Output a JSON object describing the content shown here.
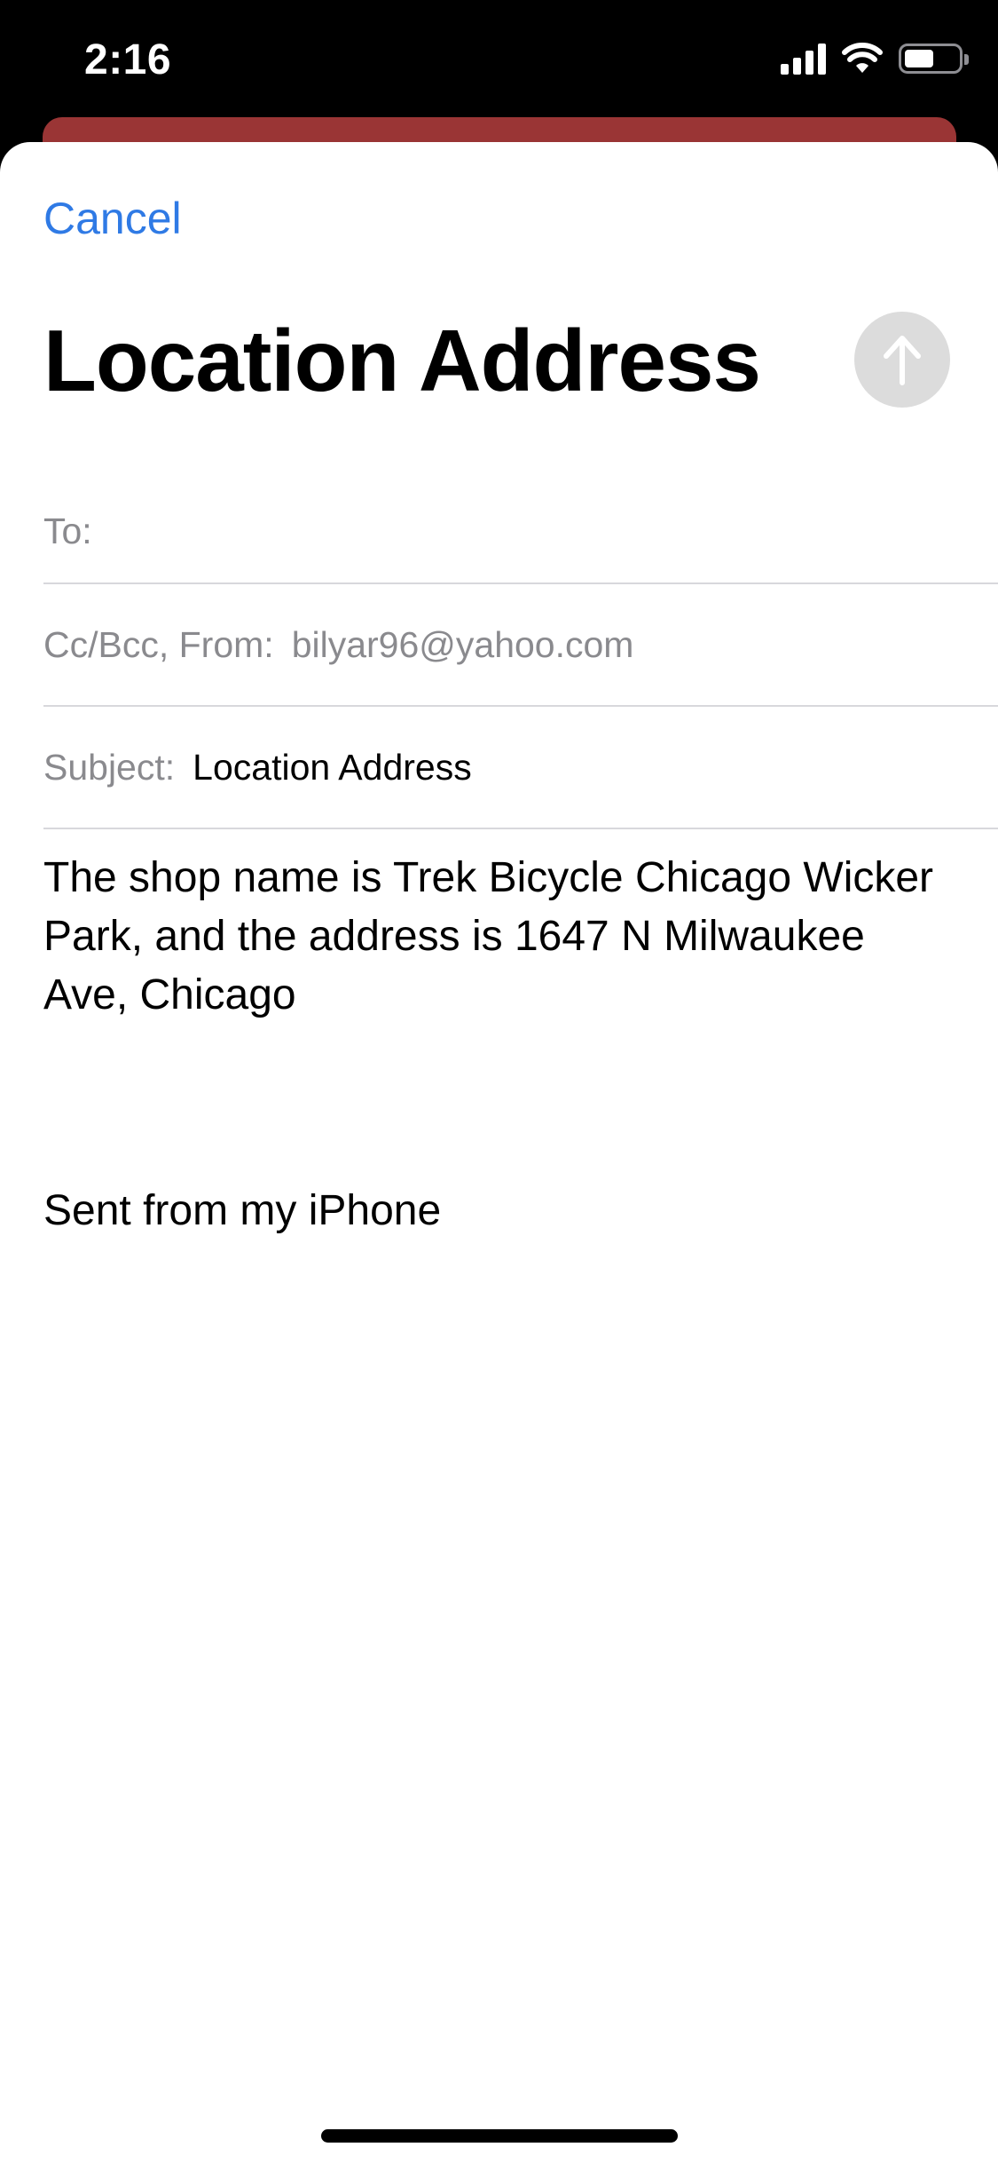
{
  "status_bar": {
    "time": "2:16",
    "icons": [
      "cellular-signal-icon",
      "wifi-icon",
      "battery-icon"
    ],
    "battery_level": 0.55
  },
  "compose": {
    "cancel_label": "Cancel",
    "title": "Location Address",
    "send_icon": "arrow-up-icon",
    "to_label": "To:",
    "to_value": "",
    "cc_bcc_from_label": "Cc/Bcc, From:",
    "from_value": "bilyar96@yahoo.com",
    "subject_label": "Subject:",
    "subject_value": "Location Address",
    "body": "The shop name is Trek Bicycle Chicago Wicker Park, and the address is 1647 N Milwaukee Ave, Chicago",
    "signature": "Sent from my iPhone"
  },
  "colors": {
    "accent": "#2f7ae5",
    "under_card": "#9a3535",
    "send_button_disabled": "#dcdcdc",
    "secondary_text": "#8a8a8e"
  }
}
